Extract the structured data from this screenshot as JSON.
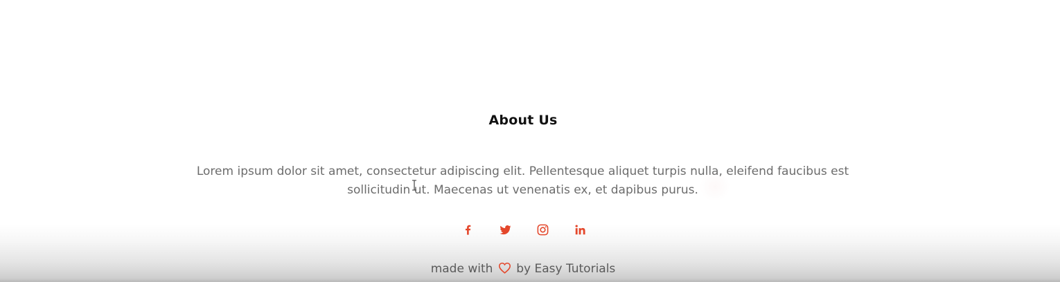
{
  "about": {
    "title": "About Us",
    "text": "Lorem ipsum dolor sit amet, consectetur adipiscing elit. Pellentesque aliquet turpis nulla, eleifend faucibus est sollicitudin ut. Maecenas ut venenatis ex, et dapibus purus."
  },
  "social": {
    "accent_color": "#e4472b",
    "links": [
      {
        "icon": "facebook-icon"
      },
      {
        "icon": "twitter-icon"
      },
      {
        "icon": "instagram-icon"
      },
      {
        "icon": "linkedin-icon"
      }
    ]
  },
  "footer": {
    "prefix": "made with",
    "heart_icon": "heart-icon",
    "suffix": "by Easy Tutorials"
  }
}
